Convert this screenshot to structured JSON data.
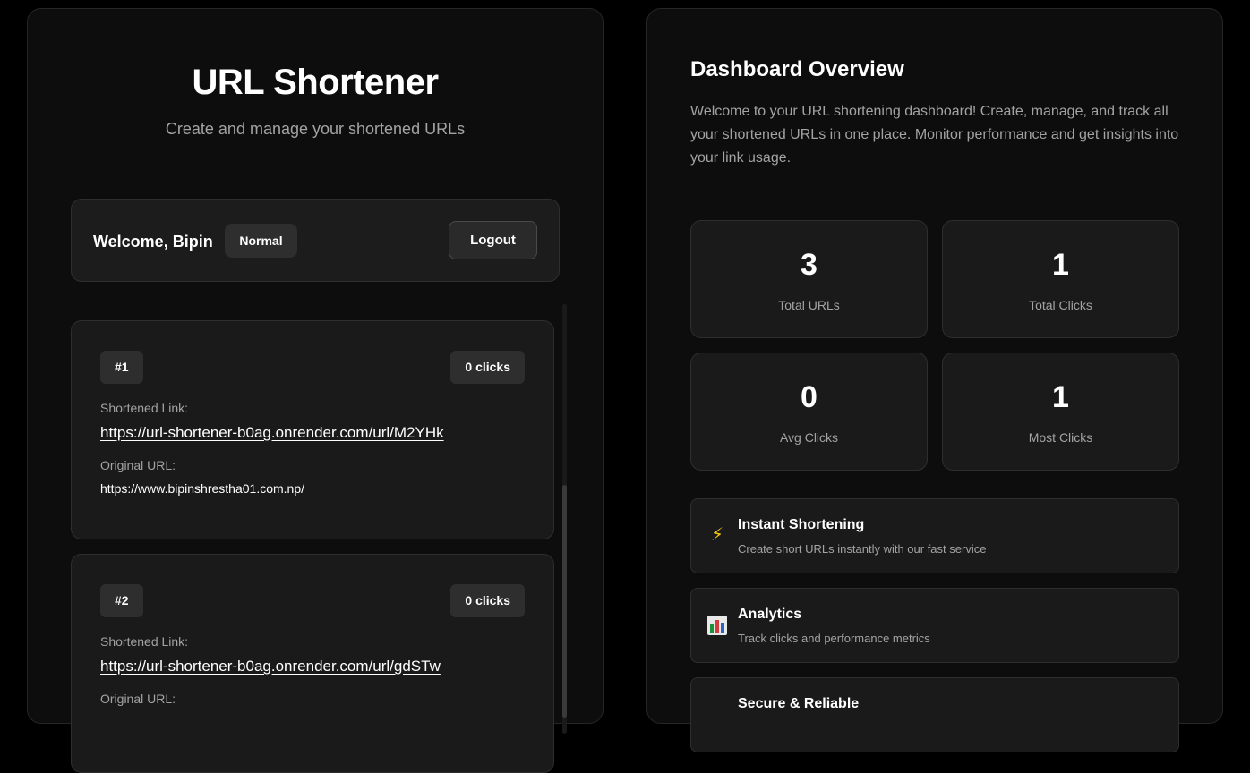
{
  "app": {
    "title": "URL Shortener",
    "subtitle": "Create and manage your shortened URLs"
  },
  "user": {
    "welcome": "Welcome, Bipin",
    "role": "Normal",
    "logout_label": "Logout"
  },
  "urls": [
    {
      "index": "#1",
      "clicks": "0 clicks",
      "short_label": "Shortened Link:",
      "short_url": "https://url-shortener-b0ag.onrender.com/url/M2YHk",
      "original_label": "Original URL:",
      "original_url": "https://www.bipinshrestha01.com.np/"
    },
    {
      "index": "#2",
      "clicks": "0 clicks",
      "short_label": "Shortened Link:",
      "short_url": "https://url-shortener-b0ag.onrender.com/url/gdSTw",
      "original_label": "Original URL:"
    }
  ],
  "dashboard": {
    "title": "Dashboard Overview",
    "description": "Welcome to your URL shortening dashboard! Create, manage, and track all your shortened URLs in one place. Monitor performance and get insights into your link usage.",
    "stats": [
      {
        "value": "3",
        "label": "Total URLs"
      },
      {
        "value": "1",
        "label": "Total Clicks"
      },
      {
        "value": "0",
        "label": "Avg Clicks"
      },
      {
        "value": "1",
        "label": "Most Clicks"
      }
    ],
    "features": [
      {
        "icon": "lightning-icon",
        "glyph": "⚡",
        "title": "Instant Shortening",
        "description": "Create short URLs instantly with our fast service"
      },
      {
        "icon": "bar-chart-icon",
        "title": "Analytics",
        "description": "Track clicks and performance metrics"
      },
      {
        "icon": "shield-icon",
        "title": "Secure & Reliable"
      }
    ]
  },
  "colors": {
    "background": "#000000",
    "panel": "#0d0d0d",
    "card": "#1a1a1a",
    "muted_text": "#a3a3a3",
    "lightning": "#f5c518"
  }
}
